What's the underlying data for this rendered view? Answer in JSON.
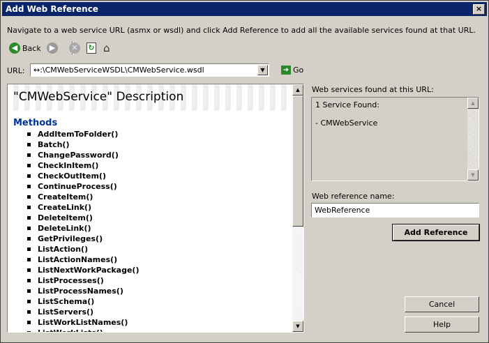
{
  "window": {
    "title": "Add Web Reference",
    "close_label": "×"
  },
  "instruction": "Navigate to a web service URL (asmx or wsdl) and click Add Reference to add all the available services found at that URL.",
  "toolbar": {
    "back_label": "Back"
  },
  "url": {
    "label": "URL:",
    "value": "↔:\\CMWebServiceWSDL\\CMWebService.wsdl",
    "go_label": "Go"
  },
  "description": {
    "title": "\"CMWebService\" Description",
    "methods_label": "Methods",
    "methods": [
      "AddItemToFolder()",
      "Batch()",
      "ChangePassword()",
      "CheckInItem()",
      "CheckOutItem()",
      "ContinueProcess()",
      "CreateItem()",
      "CreateLink()",
      "DeleteItem()",
      "DeleteLink()",
      "GetPrivileges()",
      "ListAction()",
      "ListActionNames()",
      "ListNextWorkPackage()",
      "ListProcesses()",
      "ListProcessNames()",
      "ListSchema()",
      "ListServers()",
      "ListWorkListNames()",
      "ListWorkLists()"
    ]
  },
  "services": {
    "label": "Web services found at this URL:",
    "count_text": "1 Service Found:",
    "items": [
      "- CMWebService"
    ]
  },
  "reference": {
    "label": "Web reference name:",
    "value": "WebReference"
  },
  "buttons": {
    "add_reference": "Add Reference",
    "cancel": "Cancel",
    "help": "Help"
  },
  "colors": {
    "titlebar": "#0a246a",
    "methods_heading": "#003399",
    "back_icon": "#2a8a2a",
    "forward_icon": "#808080"
  }
}
